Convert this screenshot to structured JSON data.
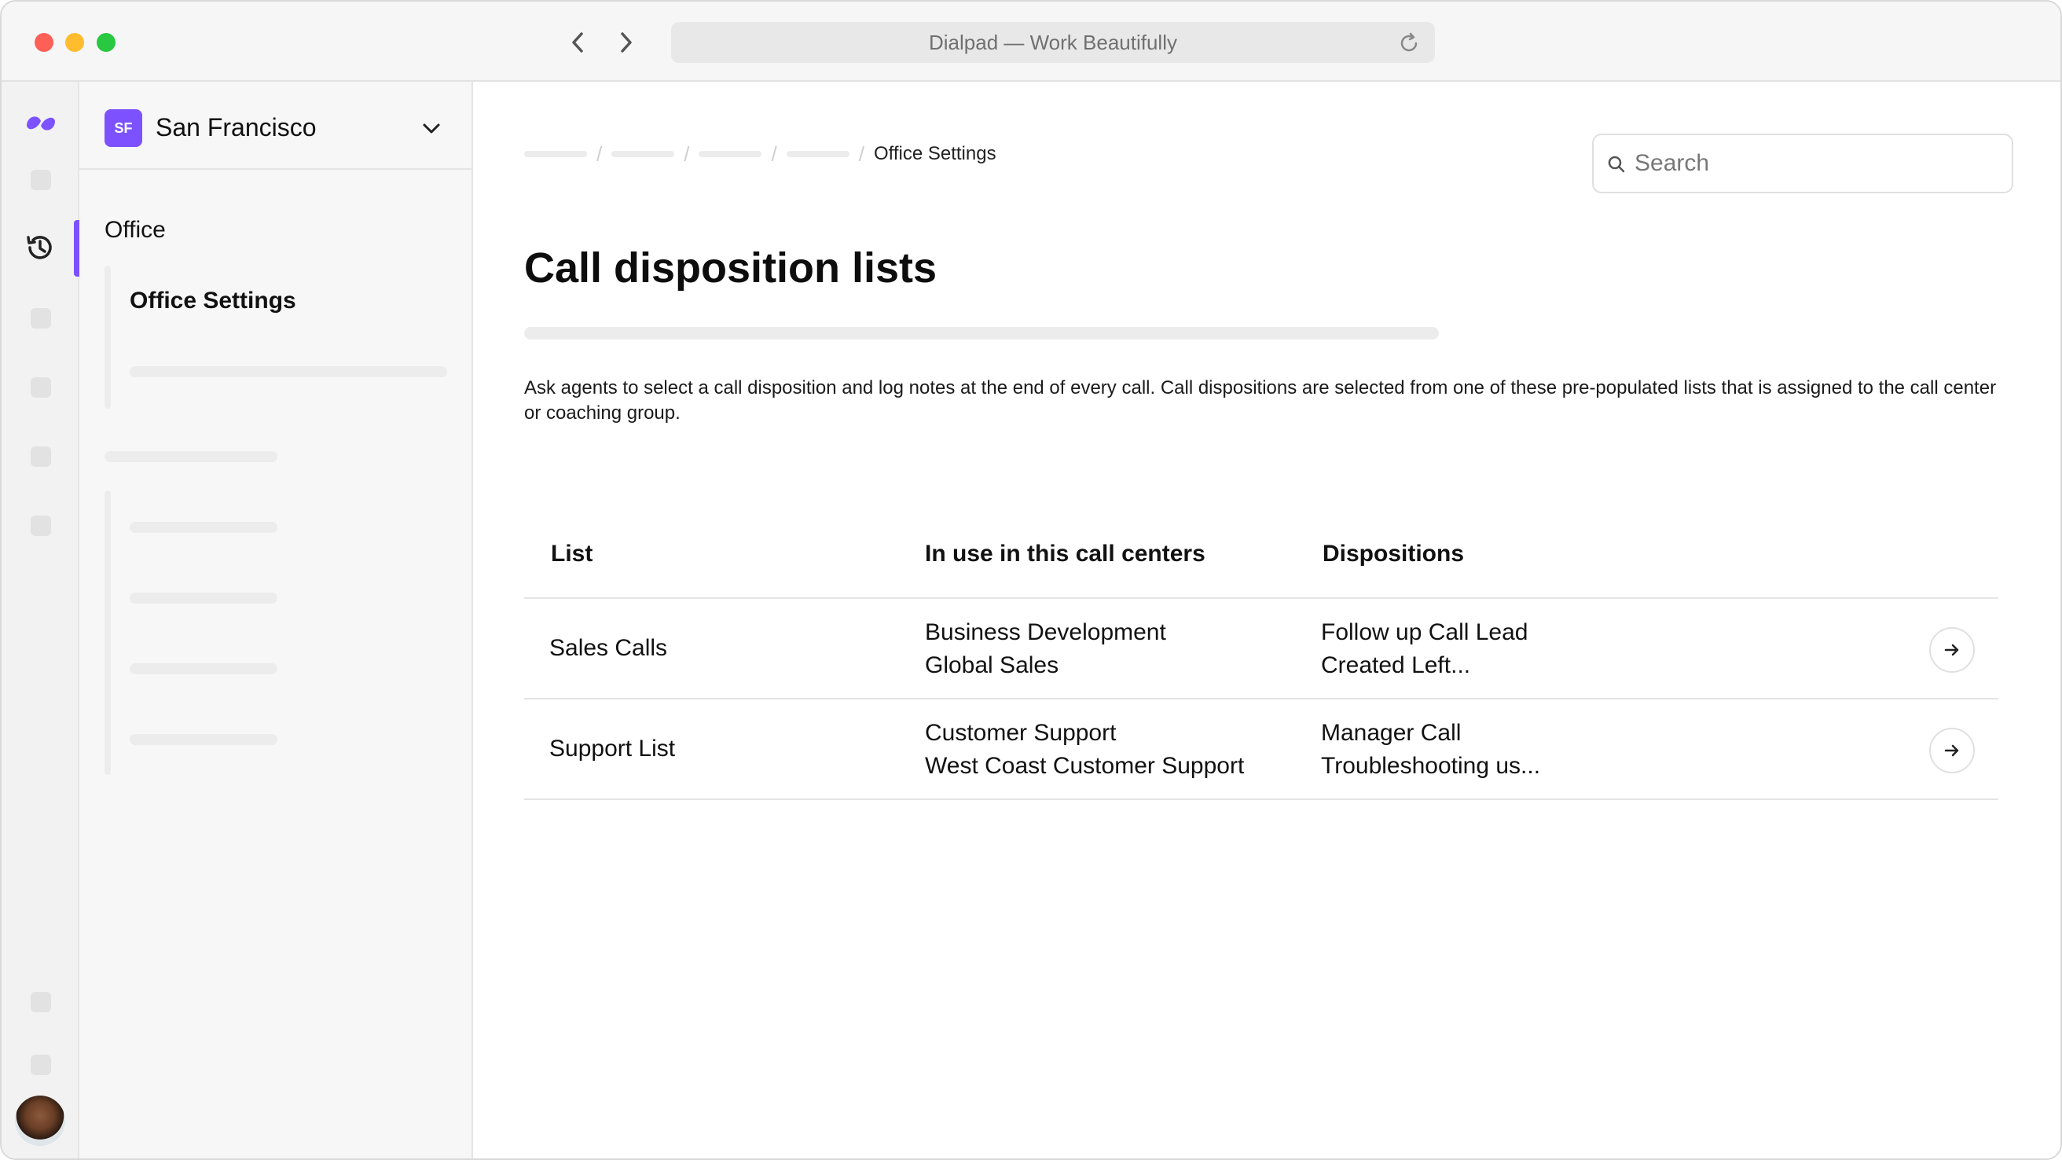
{
  "browser": {
    "url_title": "Dialpad — Work Beautifully"
  },
  "sidebar": {
    "office_initials": "SF",
    "office_name": "San Francisco",
    "section_label": "Office",
    "active_item": "Office Settings"
  },
  "main": {
    "breadcrumb_current": "Office Settings",
    "search_placeholder": "Search",
    "title": "Call disposition lists",
    "description": "Ask agents to select a call disposition and log notes at the end of every call. Call dispositions are selected from one of these pre-populated lists that is assigned to the call center or coaching group.",
    "table": {
      "headers": [
        "List",
        "In use in this call centers",
        "Dispositions"
      ],
      "rows": [
        {
          "list": "Sales Calls",
          "call_centers": [
            "Business Development",
            "Global Sales"
          ],
          "dispositions": [
            "Follow up Call Lead",
            "Created Left..."
          ]
        },
        {
          "list": "Support List",
          "call_centers": [
            "Customer Support",
            "West Coast Customer Support"
          ],
          "dispositions": [
            "Manager Call",
            "Troubleshooting us..."
          ]
        }
      ]
    }
  },
  "colors": {
    "accent": "#7c52ff",
    "traffic_red": "#fe5f57",
    "traffic_yellow": "#febc2e",
    "traffic_green": "#28c840"
  },
  "icons": [
    "chevron-left-icon",
    "chevron-right-icon",
    "reload-icon",
    "dialpad-logo-icon",
    "history-icon",
    "chevron-down-icon",
    "search-icon",
    "arrow-right-icon"
  ]
}
